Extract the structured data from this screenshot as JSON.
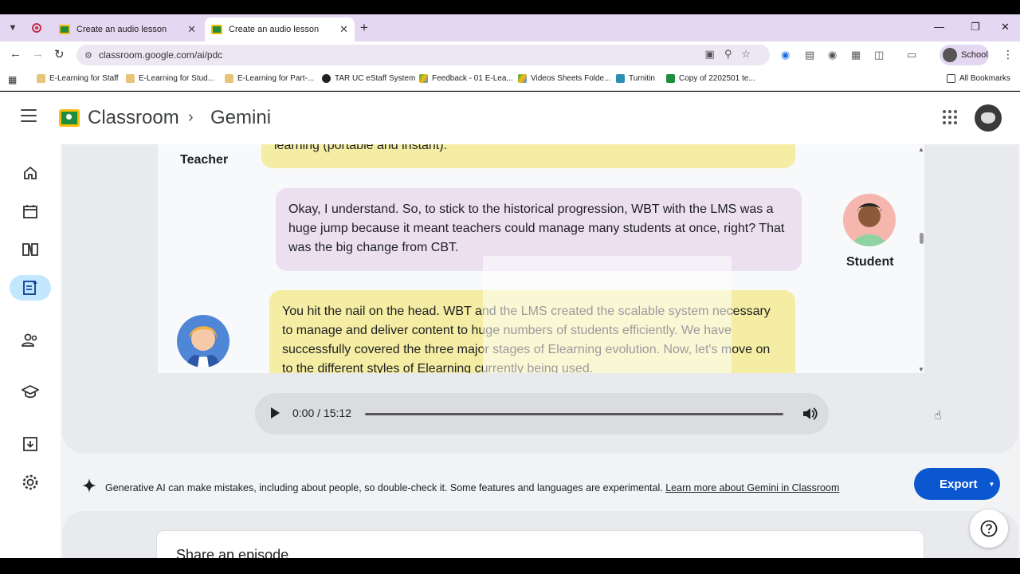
{
  "browser": {
    "tabs": [
      {
        "title": "Create an audio lesson",
        "active": false
      },
      {
        "title": "Create an audio lesson",
        "active": true
      }
    ],
    "url": "classroom.google.com/ai/pdc",
    "profile_label": "School",
    "bookmarks": [
      {
        "label": "E-Learning for Staff",
        "icon": "folder-icon"
      },
      {
        "label": "E-Learning for Stud...",
        "icon": "folder-icon"
      },
      {
        "label": "E-Learning for Part-...",
        "icon": "folder-icon"
      },
      {
        "label": "TAR UC eStaff System",
        "icon": "globe-icon"
      },
      {
        "label": "Feedback - 01 E-Lea...",
        "icon": "drive-icon"
      },
      {
        "label": "Videos Sheets Folde...",
        "icon": "drive-icon"
      },
      {
        "label": "Turnitin",
        "icon": "turnitin-icon"
      },
      {
        "label": "Copy of 2202501 te...",
        "icon": "sheets-icon"
      }
    ],
    "all_bookmarks_label": "All Bookmarks"
  },
  "app": {
    "title": "Classroom",
    "breadcrumb": "Gemini",
    "nav_icons": [
      "home-icon",
      "calendar-icon",
      "book-icon",
      "audio-lesson-icon",
      "people-icon",
      "school-icon",
      "archive-icon",
      "settings-icon"
    ]
  },
  "transcript": {
    "messages": [
      {
        "speaker": "Teacher",
        "text": "learning (portable and instant)."
      },
      {
        "speaker": "Student",
        "text": "Okay, I understand. So, to stick to the historical progression, WBT with the LMS was a huge jump because it meant teachers could manage many students at once, right? That was the big change from CBT."
      },
      {
        "speaker": "Teacher",
        "text": "You hit the nail on the head. WBT and the LMS created the scalable system necessary to manage and deliver content to huge numbers of students efficiently. We have successfully covered the three major stages of Elearning evolution. Now, let's move on to the different styles of Elearning currently being used."
      }
    ],
    "teacher_label": "Teacher",
    "student_label": "Student"
  },
  "player": {
    "time": "0:00 / 15:12",
    "progress": 0
  },
  "disclaimer": {
    "text": "Generative AI can make mistakes, including about people, so double-check it. Some features and languages are experimental.",
    "link": "Learn more about Gemini in Classroom"
  },
  "export": {
    "label": "Export"
  },
  "share": {
    "title": "Share an episode"
  },
  "colors": {
    "accent": "#0b57d0",
    "teacher_bubble": "#f4eda3",
    "student_bubble": "#ebdff0",
    "tab_strip": "#e3d7f1"
  }
}
